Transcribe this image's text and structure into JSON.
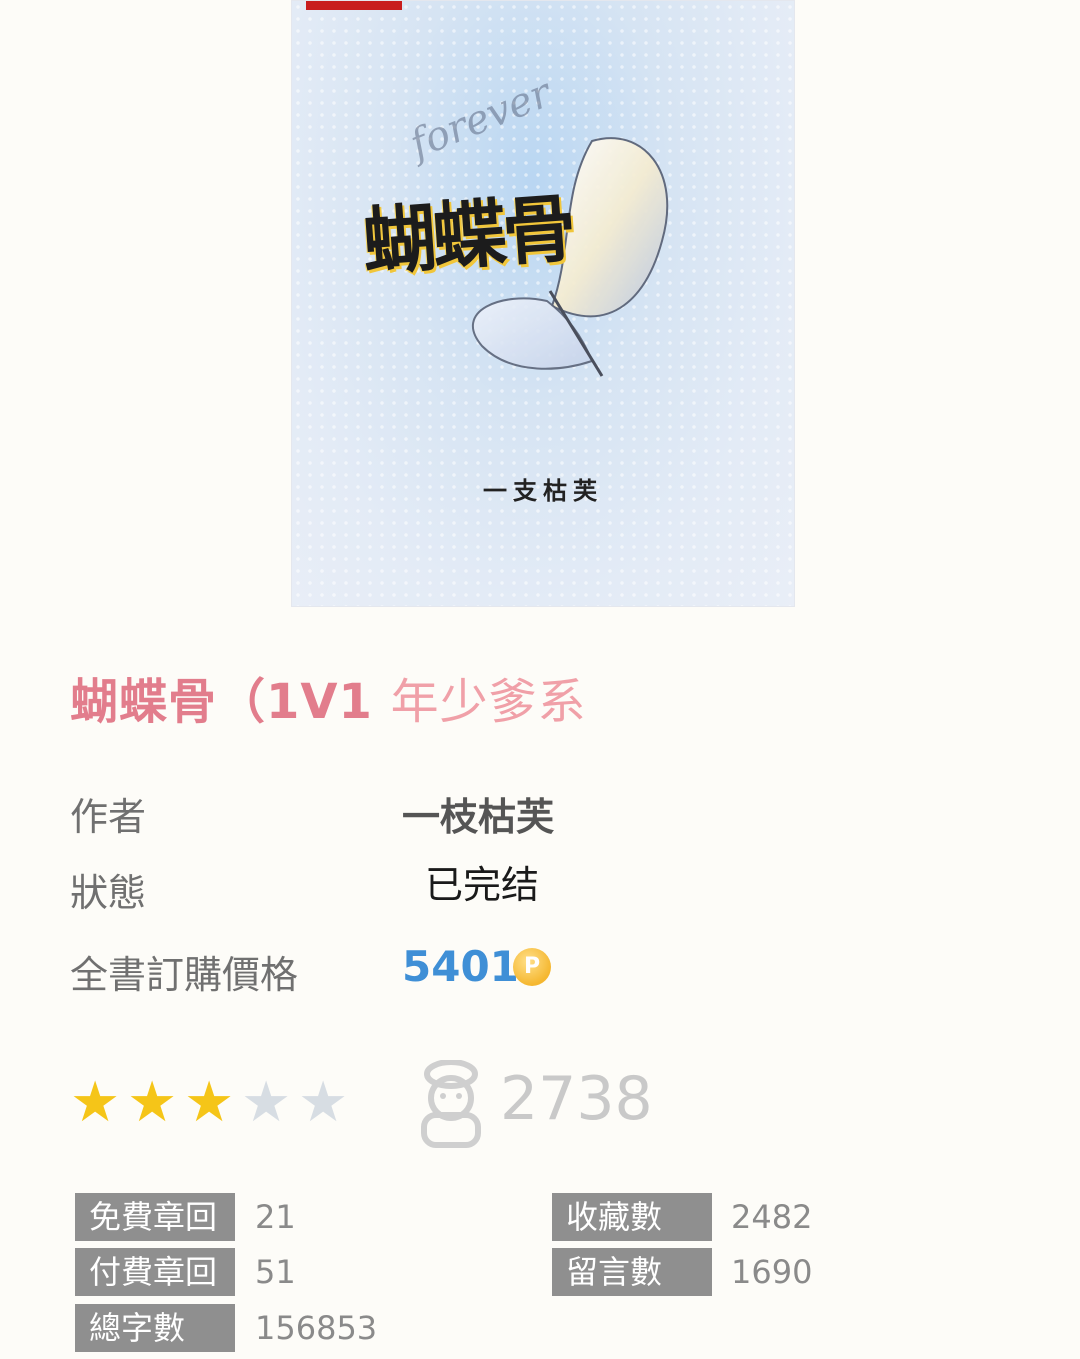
{
  "cover": {
    "title": "蝴蝶骨",
    "author": "一支枯芙",
    "script": "forever"
  },
  "book": {
    "title": "蝴蝶骨（1V1 ",
    "title_tail": "年少爹系"
  },
  "info": {
    "author_label": "作者",
    "author": "一枝枯芙",
    "status_label": "狀態",
    "status": "已完结",
    "price_label": "全書訂購價格",
    "price": "5401",
    "coin_symbol": "P"
  },
  "rating": {
    "stars_filled": 3,
    "stars_total": 5,
    "hits": "2738"
  },
  "stats": {
    "free_chapters_label": "免費章回",
    "free_chapters": "21",
    "paid_chapters_label": "付費章回",
    "paid_chapters": "51",
    "total_words_label": "總字數",
    "total_words": "156853",
    "favorites_label": "收藏數",
    "favorites": "2482",
    "comments_label": "留言數",
    "comments": "1690"
  },
  "colors": {
    "title": "#e27d8c",
    "price": "#3f8fd6",
    "star_filled": "#f5c518",
    "star_empty": "#d7dde3",
    "stat_label_bg": "#8f8f8f"
  }
}
